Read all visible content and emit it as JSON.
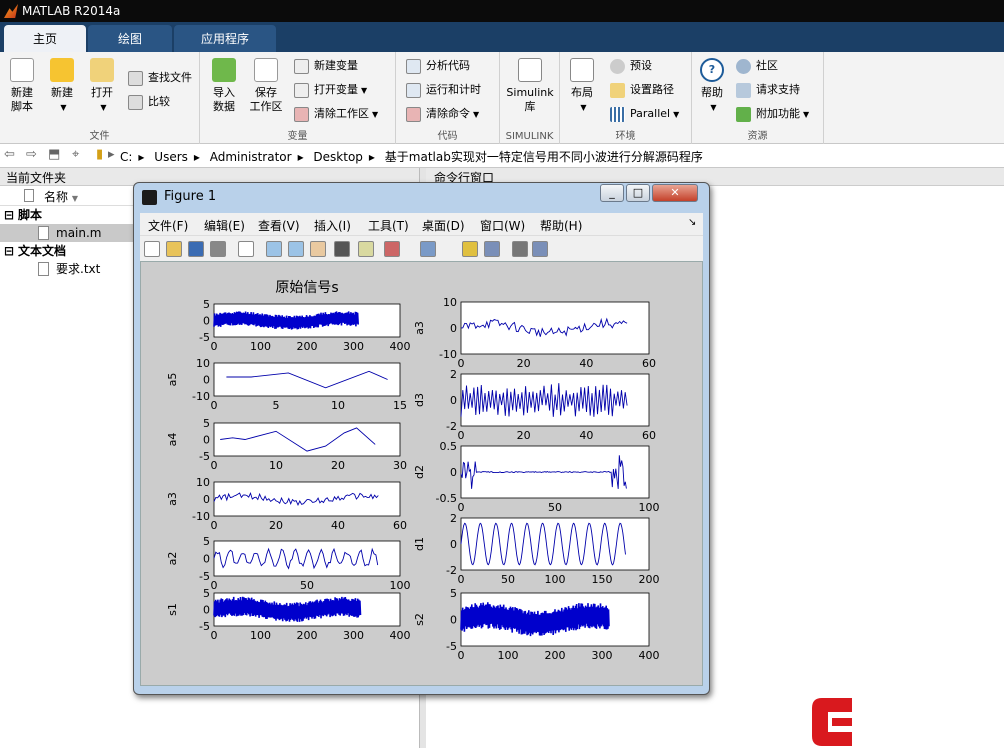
{
  "app": {
    "title": "MATLAB R2014a"
  },
  "tabs": [
    {
      "label": "主页",
      "active": true
    },
    {
      "label": "绘图",
      "active": false
    },
    {
      "label": "应用程序",
      "active": false
    }
  ],
  "ribbon": {
    "file_group": {
      "label": "文件",
      "new_script": "新建\n脚本",
      "new": "新建",
      "open": "打开",
      "find_files": "查找文件",
      "compare": "比较"
    },
    "variable_group": {
      "label": "变量",
      "import_data": "导入\n数据",
      "save_workspace": "保存\n工作区",
      "new_variable": "新建变量",
      "open_variable": "打开变量",
      "clear_workspace": "清除工作区"
    },
    "code_group": {
      "label": "代码",
      "analyze_code": "分析代码",
      "run_and_time": "运行和计时",
      "clear_commands": "清除命令"
    },
    "simulink_group": {
      "label": "SIMULINK",
      "simulink_library": "Simulink\n库"
    },
    "environment_group": {
      "label": "环境",
      "layout": "布局",
      "preferences": "预设",
      "set_path": "设置路径",
      "parallel": "Parallel"
    },
    "resources_group": {
      "label": "资源",
      "help": "帮助",
      "community": "社区",
      "request_support": "请求支持",
      "addons": "附加功能"
    }
  },
  "address": {
    "crumbs": [
      "C:",
      "Users",
      "Administrator",
      "Desktop",
      "基于matlab实现对一特定信号用不同小波进行分解源码程序"
    ]
  },
  "current_folder": {
    "title": "当前文件夹",
    "name_column": "名称",
    "groups": [
      {
        "label": "脚本",
        "files": [
          "main.m"
        ]
      },
      {
        "label": "文本文档",
        "files": [
          "要求.txt"
        ]
      }
    ]
  },
  "command_window": {
    "title": "命令行窗口"
  },
  "figure": {
    "title": "Figure 1",
    "menu": [
      "文件(F)",
      "编辑(E)",
      "查看(V)",
      "插入(I)",
      "工具(T)",
      "桌面(D)",
      "窗口(W)",
      "帮助(H)"
    ],
    "plot_title": "原始信号s",
    "icons": {
      "toolbar": [
        "new-figure-icon",
        "open-icon",
        "save-icon",
        "print-icon",
        "pointer-icon",
        "zoom-in-icon",
        "zoom-out-icon",
        "pan-icon",
        "rotate-icon",
        "data-cursor-icon",
        "brush-icon",
        "link-icon",
        "colorbar-icon",
        "legend-icon",
        "hide-plot-tools-icon",
        "show-plot-tools-icon"
      ]
    }
  },
  "chart_data": [
    {
      "type": "line",
      "title": "原始信号s",
      "xlabel": "",
      "ylabel": "",
      "xlim": [
        0,
        400
      ],
      "ylim": [
        -5,
        5
      ],
      "xticks": [
        "0",
        "100",
        "200",
        "300",
        "400"
      ],
      "yticks": [
        "5",
        "0",
        "-5"
      ],
      "x_end": 310,
      "shape": "dense",
      "amp": 2.2,
      "color": "#0000cc"
    },
    {
      "type": "line",
      "title": "",
      "xlabel": "",
      "ylabel": "a5",
      "xlim": [
        0,
        15
      ],
      "ylim": [
        -10,
        10
      ],
      "xticks": [
        "0",
        "5",
        "10",
        "15"
      ],
      "yticks": [
        "10",
        "0",
        "-10"
      ],
      "points": [
        [
          1,
          1.5
        ],
        [
          3,
          1.5
        ],
        [
          6,
          4
        ],
        [
          9,
          -5
        ],
        [
          12.5,
          5
        ],
        [
          14,
          0
        ]
      ],
      "shape": "points",
      "color": "#0000aa"
    },
    {
      "type": "line",
      "title": "",
      "xlabel": "",
      "ylabel": "a4",
      "xlim": [
        0,
        30
      ],
      "ylim": [
        -5,
        5
      ],
      "xticks": [
        "0",
        "10",
        "20",
        "30"
      ],
      "yticks": [
        "5",
        "0",
        "-5"
      ],
      "points": [
        [
          1,
          0
        ],
        [
          3,
          0.5
        ],
        [
          5,
          0
        ],
        [
          10,
          2.5
        ],
        [
          15,
          -3.5
        ],
        [
          18,
          -2
        ],
        [
          21,
          2
        ],
        [
          23,
          3.5
        ],
        [
          26,
          -1.5
        ]
      ],
      "shape": "points",
      "color": "#0000aa"
    },
    {
      "type": "line",
      "title": "",
      "xlabel": "",
      "ylabel": "a3",
      "xlim": [
        0,
        60
      ],
      "ylim": [
        -10,
        10
      ],
      "xticks": [
        "0",
        "20",
        "40",
        "60"
      ],
      "yticks": [
        "10",
        "0",
        "-10"
      ],
      "x_end": 53,
      "shape": "noisy",
      "amp": 3,
      "color": "#0000aa"
    },
    {
      "type": "line",
      "title": "",
      "xlabel": "",
      "ylabel": "a2",
      "xlim": [
        0,
        100
      ],
      "ylim": [
        -5,
        5
      ],
      "xticks": [
        "0",
        "50",
        "100"
      ],
      "yticks": [
        "5",
        "0",
        "-5"
      ],
      "x_end": 88,
      "shape": "wavy",
      "amp": 3,
      "color": "#0000aa"
    },
    {
      "type": "line",
      "title": "",
      "xlabel": "",
      "ylabel": "s1",
      "xlim": [
        0,
        400
      ],
      "ylim": [
        -5,
        5
      ],
      "xticks": [
        "0",
        "100",
        "200",
        "300",
        "400"
      ],
      "yticks": [
        "5",
        "0",
        "-5"
      ],
      "x_end": 315,
      "shape": "dense",
      "amp": 3,
      "color": "#0000cc"
    },
    {
      "type": "line",
      "title": "",
      "xlabel": "",
      "ylabel": "a3",
      "xlim": [
        0,
        60
      ],
      "ylim": [
        -10,
        10
      ],
      "xticks": [
        "0",
        "20",
        "40",
        "60"
      ],
      "yticks": [
        "10",
        "0",
        "-10"
      ],
      "x_end": 53,
      "shape": "noisy",
      "amp": 3,
      "color": "#0000aa"
    },
    {
      "type": "line",
      "title": "",
      "xlabel": "",
      "ylabel": "d3",
      "xlim": [
        0,
        60
      ],
      "ylim": [
        -2,
        2
      ],
      "xticks": [
        "0",
        "20",
        "40",
        "60"
      ],
      "yticks": [
        "2",
        "0",
        "-2"
      ],
      "x_end": 53,
      "shape": "zigzag",
      "amp": 1.3,
      "color": "#0000aa"
    },
    {
      "type": "line",
      "title": "",
      "xlabel": "",
      "ylabel": "d2",
      "xlim": [
        0,
        100
      ],
      "ylim": [
        -0.5,
        0.5
      ],
      "xticks": [
        "0",
        "50",
        "100"
      ],
      "yticks": [
        "0.5",
        "0",
        "-0.5"
      ],
      "x_end": 88,
      "shape": "spiky",
      "amp": 0.3,
      "color": "#0000aa"
    },
    {
      "type": "line",
      "title": "",
      "xlabel": "",
      "ylabel": "d1",
      "xlim": [
        0,
        200
      ],
      "ylim": [
        -2,
        2
      ],
      "xticks": [
        "0",
        "50",
        "100",
        "150",
        "200"
      ],
      "yticks": [
        "2",
        "0",
        "-2"
      ],
      "x_end": 175,
      "shape": "sine",
      "amp": 1.6,
      "color": "#0000aa"
    },
    {
      "type": "line",
      "title": "",
      "xlabel": "",
      "ylabel": "s2",
      "xlim": [
        0,
        400
      ],
      "ylim": [
        -5,
        5
      ],
      "xticks": [
        "0",
        "100",
        "200",
        "300",
        "400"
      ],
      "yticks": [
        "5",
        "0",
        "-5"
      ],
      "x_end": 315,
      "shape": "dense",
      "amp": 2.5,
      "color": "#0000cc"
    }
  ]
}
